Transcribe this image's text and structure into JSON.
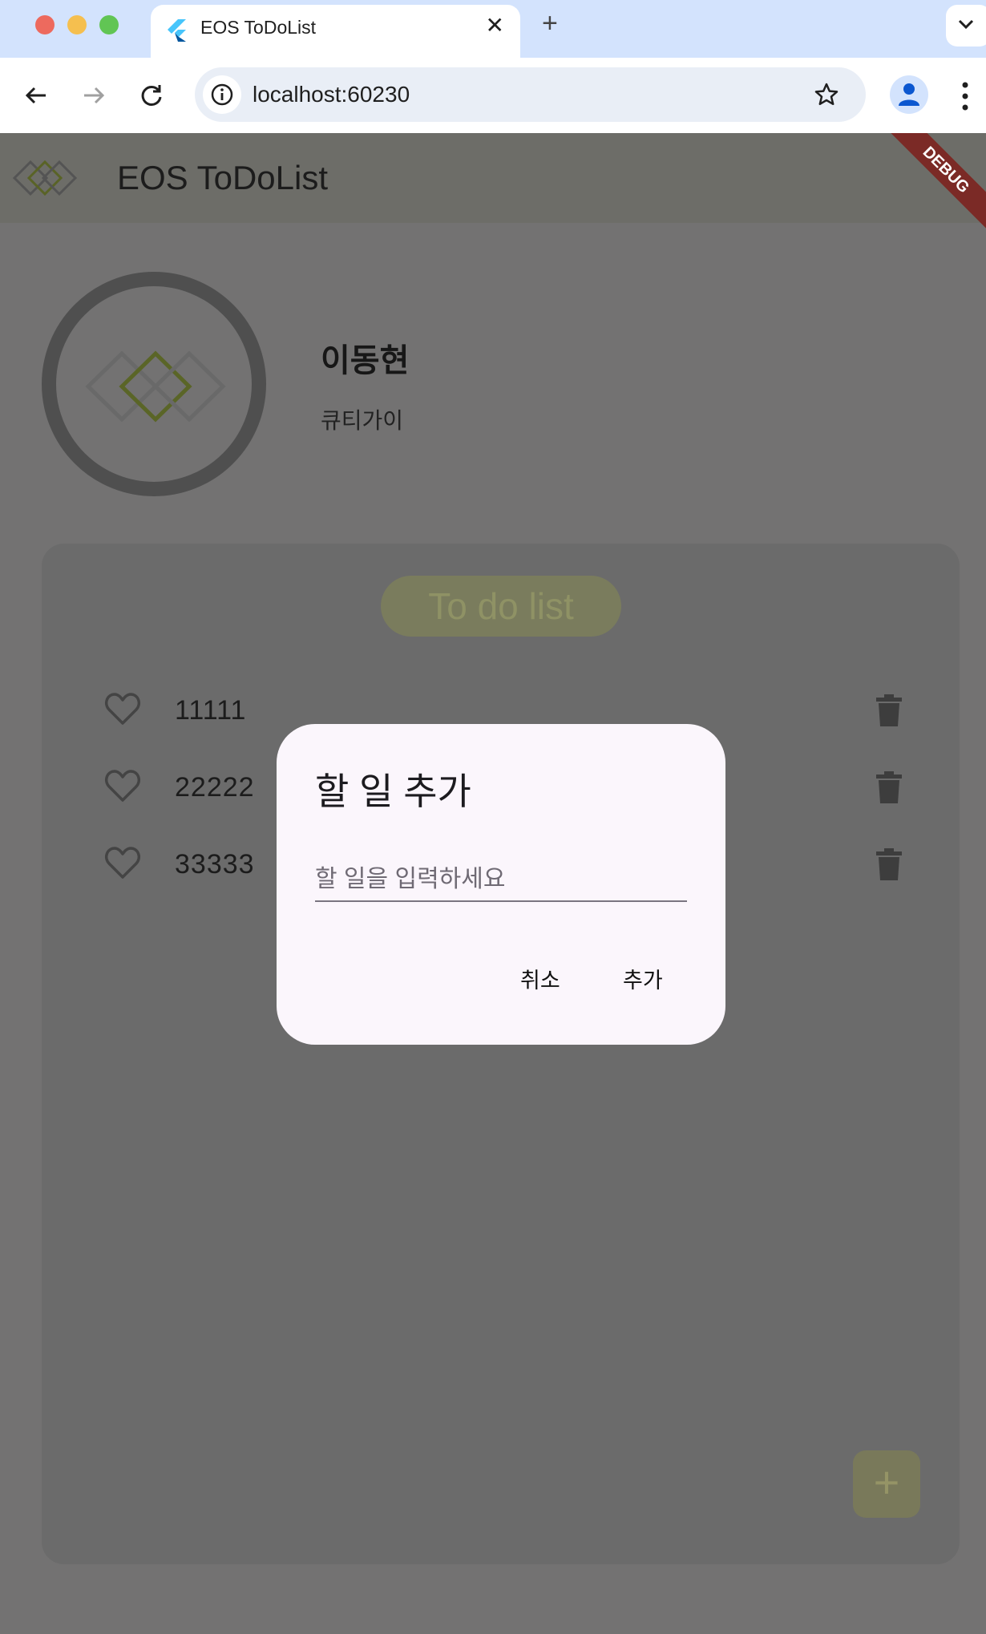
{
  "browser": {
    "tab_title": "EOS ToDoList",
    "tab_close": "✕",
    "new_tab": "+",
    "url": "localhost:60230"
  },
  "app": {
    "title": "EOS ToDoList",
    "debug_banner": "DEBUG"
  },
  "profile": {
    "name": "이동현",
    "subtitle": "큐티가이"
  },
  "todo": {
    "header": "To do list",
    "items": [
      {
        "text": "11111"
      },
      {
        "text": "22222"
      },
      {
        "text": "33333"
      }
    ],
    "fab": "+"
  },
  "dialog": {
    "title": "할 일 추가",
    "input_placeholder": "할 일을 입력하세요",
    "input_value": "",
    "cancel": "취소",
    "add": "추가"
  },
  "colors": {
    "scrim": "#737272",
    "dialog_bg": "#fbf6fc",
    "accent_olive": "#7a7c5d",
    "tab_strip": "#d3e3fd"
  }
}
